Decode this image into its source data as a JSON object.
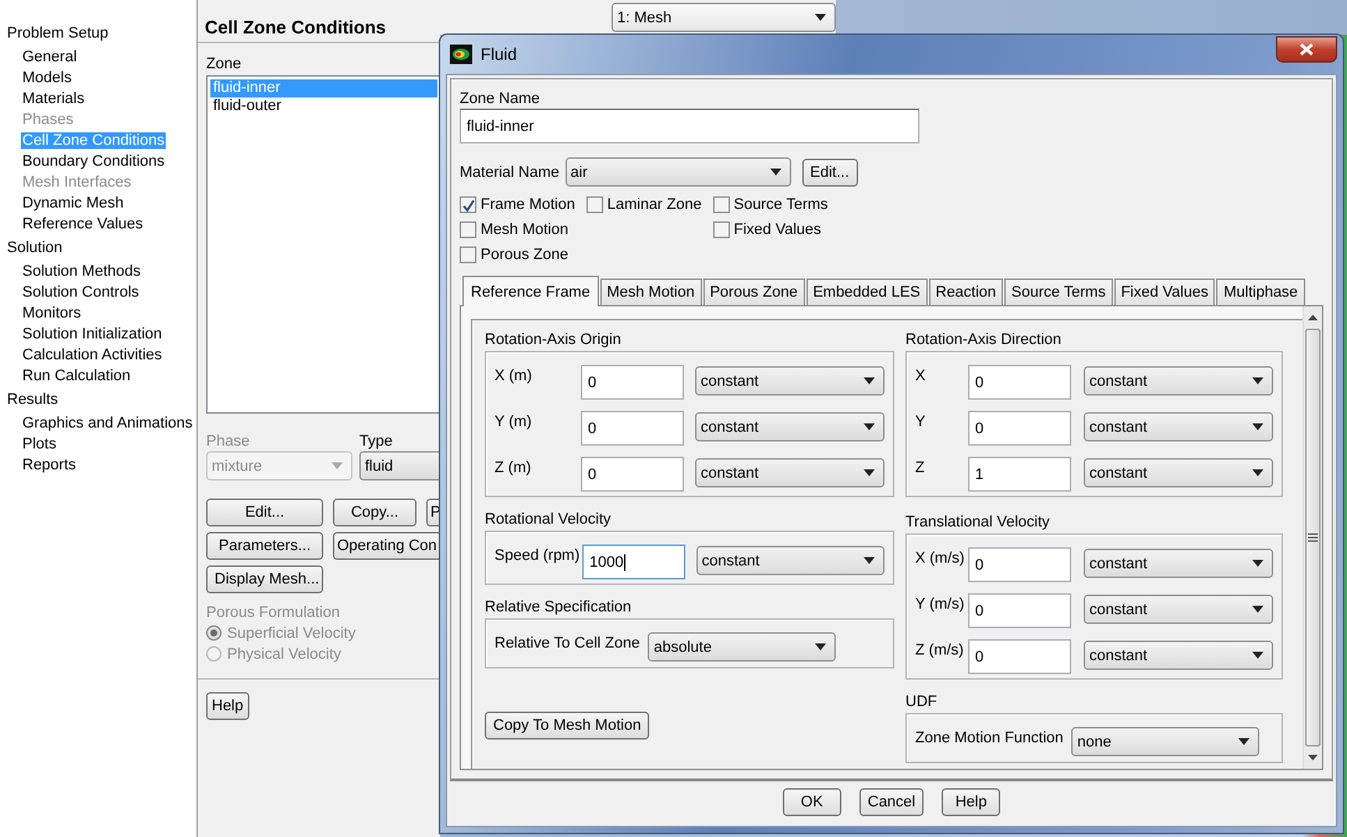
{
  "sidebar": [
    {
      "label": "Problem Setup",
      "children": [
        {
          "label": "General",
          "selected": false,
          "disabled": false
        },
        {
          "label": "Models",
          "selected": false,
          "disabled": false
        },
        {
          "label": "Materials",
          "selected": false,
          "disabled": false
        },
        {
          "label": "Phases",
          "selected": false,
          "disabled": true
        },
        {
          "label": "Cell Zone Conditions",
          "selected": true,
          "disabled": false
        },
        {
          "label": "Boundary Conditions",
          "selected": false,
          "disabled": false
        },
        {
          "label": "Mesh Interfaces",
          "selected": false,
          "disabled": true
        },
        {
          "label": "Dynamic Mesh",
          "selected": false,
          "disabled": false
        },
        {
          "label": "Reference Values",
          "selected": false,
          "disabled": false
        }
      ]
    },
    {
      "label": "Solution",
      "children": [
        {
          "label": "Solution Methods",
          "selected": false,
          "disabled": false
        },
        {
          "label": "Solution Controls",
          "selected": false,
          "disabled": false
        },
        {
          "label": "Monitors",
          "selected": false,
          "disabled": false
        },
        {
          "label": "Solution Initialization",
          "selected": false,
          "disabled": false
        },
        {
          "label": "Calculation Activities",
          "selected": false,
          "disabled": false
        },
        {
          "label": "Run Calculation",
          "selected": false,
          "disabled": false
        }
      ]
    },
    {
      "label": "Results",
      "children": [
        {
          "label": "Graphics and Animations",
          "selected": false,
          "disabled": false
        },
        {
          "label": "Plots",
          "selected": false,
          "disabled": false
        },
        {
          "label": "Reports",
          "selected": false,
          "disabled": false
        }
      ]
    }
  ],
  "panel": {
    "title": "Cell Zone Conditions",
    "zone_label": "Zone",
    "zones": [
      {
        "label": "fluid-inner",
        "selected": true
      },
      {
        "label": "fluid-outer",
        "selected": false
      }
    ],
    "phase": {
      "label": "Phase",
      "value": "mixture",
      "disabled": true
    },
    "type": {
      "label": "Type",
      "value": "fluid"
    },
    "button_rows": [
      [
        {
          "label": "Edit..."
        },
        {
          "label": "Copy..."
        },
        {
          "label": "P"
        }
      ],
      [
        {
          "label": "Parameters..."
        },
        {
          "label": "Operating Con"
        }
      ],
      [
        {
          "label": "Display Mesh..."
        }
      ]
    ],
    "porous": {
      "label": "Porous Formulation",
      "disabled": true,
      "options": [
        {
          "label": "Superficial Velocity",
          "selected": true
        },
        {
          "label": "Physical Velocity",
          "selected": false
        }
      ]
    },
    "help": "Help"
  },
  "view": {
    "value": "1: Mesh"
  },
  "dialog": {
    "title": "Fluid",
    "zone_name_label": "Zone Name",
    "zone_name": "fluid-inner",
    "material_label": "Material Name",
    "material": "air",
    "material_edit": "Edit...",
    "option_columns": [
      [
        {
          "label": "Frame Motion",
          "checked": true
        },
        {
          "label": "Mesh Motion",
          "checked": false
        },
        {
          "label": "Porous Zone",
          "checked": false
        }
      ],
      [
        {
          "label": "Laminar Zone",
          "checked": false
        }
      ],
      [
        {
          "label": "Source Terms",
          "checked": false
        },
        {
          "label": "Fixed Values",
          "checked": false
        }
      ]
    ],
    "tabs": [
      {
        "label": "Reference Frame",
        "selected": true
      },
      {
        "label": "Mesh Motion",
        "selected": false
      },
      {
        "label": "Porous Zone",
        "selected": false
      },
      {
        "label": "Embedded LES",
        "selected": false
      },
      {
        "label": "Reaction",
        "selected": false
      },
      {
        "label": "Source Terms",
        "selected": false
      },
      {
        "label": "Fixed Values",
        "selected": false
      },
      {
        "label": "Multiphase",
        "selected": false
      }
    ],
    "columns": [
      [
        {
          "kind": "group",
          "title": "Rotation-Axis Origin",
          "rows": [
            {
              "kind": "field",
              "label": "X (m)",
              "value": "0",
              "method": "constant",
              "focused": false
            },
            {
              "kind": "field",
              "label": "Y (m)",
              "value": "0",
              "method": "constant",
              "focused": false
            },
            {
              "kind": "field",
              "label": "Z (m)",
              "value": "0",
              "method": "constant",
              "focused": false
            }
          ]
        },
        {
          "kind": "group",
          "title": "Rotational Velocity",
          "rows": [
            {
              "kind": "field",
              "label": "Speed (rpm)",
              "value": "1000",
              "method": "constant",
              "focused": true
            }
          ]
        },
        {
          "kind": "group",
          "title": "Relative Specification",
          "rows": [
            {
              "kind": "select",
              "label": "Relative To Cell Zone",
              "value": "absolute"
            }
          ]
        },
        {
          "kind": "button",
          "label": "Copy To Mesh Motion"
        }
      ],
      [
        {
          "kind": "group",
          "title": "Rotation-Axis Direction",
          "rows": [
            {
              "kind": "field",
              "label": "X",
              "value": "0",
              "method": "constant",
              "focused": false
            },
            {
              "kind": "field",
              "label": "Y",
              "value": "0",
              "method": "constant",
              "focused": false
            },
            {
              "kind": "field",
              "label": "Z",
              "value": "1",
              "method": "constant",
              "focused": false
            }
          ]
        },
        {
          "kind": "group",
          "title": "Translational Velocity",
          "rows": [
            {
              "kind": "field",
              "label": "X (m/s)",
              "value": "0",
              "method": "constant",
              "focused": false
            },
            {
              "kind": "field",
              "label": "Y (m/s)",
              "value": "0",
              "method": "constant",
              "focused": false
            },
            {
              "kind": "field",
              "label": "Z (m/s)",
              "value": "0",
              "method": "constant",
              "focused": false
            }
          ]
        },
        {
          "kind": "group",
          "title": "UDF",
          "rows": [
            {
              "kind": "select",
              "label": "Zone Motion Function",
              "value": "none"
            }
          ]
        }
      ]
    ],
    "buttons": [
      "OK",
      "Cancel",
      "Help"
    ]
  }
}
